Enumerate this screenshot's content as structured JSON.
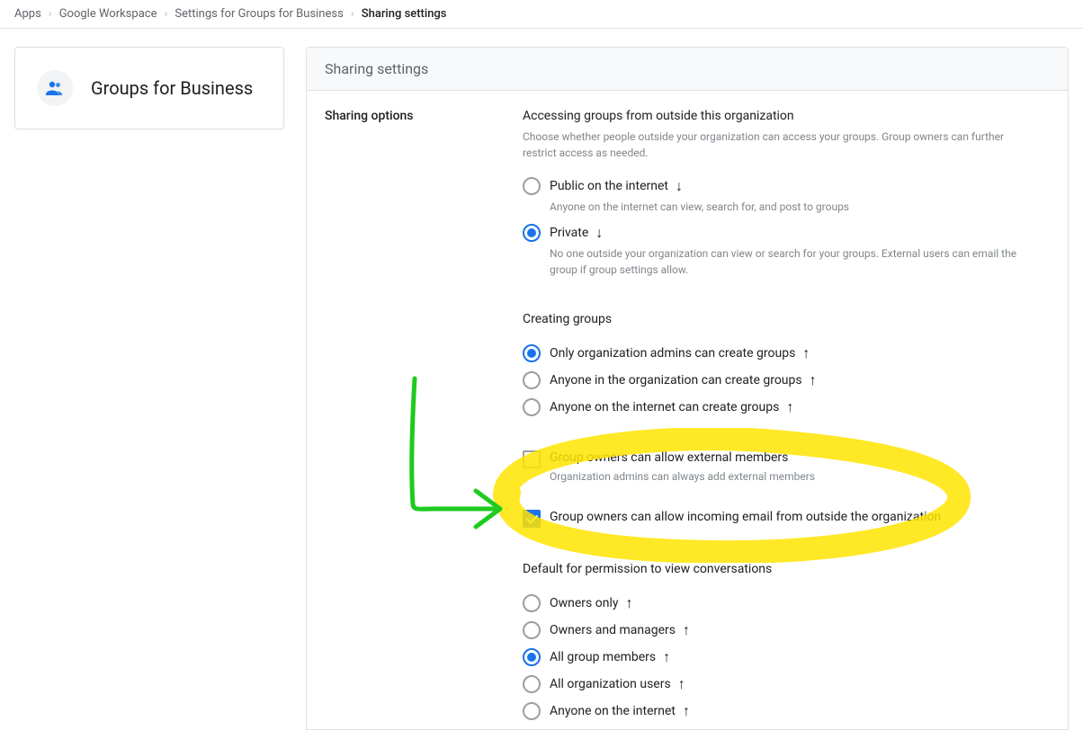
{
  "breadcrumb": {
    "items": [
      "Apps",
      "Google Workspace",
      "Settings for Groups for Business",
      "Sharing settings"
    ]
  },
  "card": {
    "title": "Groups for Business"
  },
  "main": {
    "header": "Sharing settings",
    "sideLabel": "Sharing options",
    "access": {
      "title": "Accessing groups from outside this organization",
      "sub": "Choose whether people outside your organization can access your groups. Group owners can further restrict access as needed.",
      "options": [
        {
          "label": "Public on the internet",
          "arrow": "↓",
          "desc": "Anyone on the internet can view, search for, and post to groups",
          "selected": false
        },
        {
          "label": "Private",
          "arrow": "↓",
          "desc": "No one outside your organization can view or search for your groups. External users can email the group if group settings allow.",
          "selected": true
        }
      ]
    },
    "creating": {
      "title": "Creating groups",
      "options": [
        {
          "label": "Only organization admins can create groups",
          "arrow": "↑",
          "selected": true
        },
        {
          "label": "Anyone in the organization can create groups",
          "arrow": "↑",
          "selected": false
        },
        {
          "label": "Anyone on the internet can create groups",
          "arrow": "↑",
          "selected": false
        }
      ]
    },
    "checks": [
      {
        "label": "Group owners can allow external members",
        "desc": "Organization admins can always add external members",
        "checked": false
      },
      {
        "label": "Group owners can allow incoming email from outside the organization",
        "desc": "",
        "checked": true
      }
    ],
    "viewPerm": {
      "title": "Default for permission to view conversations",
      "options": [
        {
          "label": "Owners only",
          "arrow": "↑",
          "selected": false
        },
        {
          "label": "Owners and managers",
          "arrow": "↑",
          "selected": false
        },
        {
          "label": "All group members",
          "arrow": "↑",
          "selected": true
        },
        {
          "label": "All organization users",
          "arrow": "↑",
          "selected": false
        },
        {
          "label": "Anyone on the internet",
          "arrow": "↑",
          "selected": false
        }
      ]
    }
  }
}
